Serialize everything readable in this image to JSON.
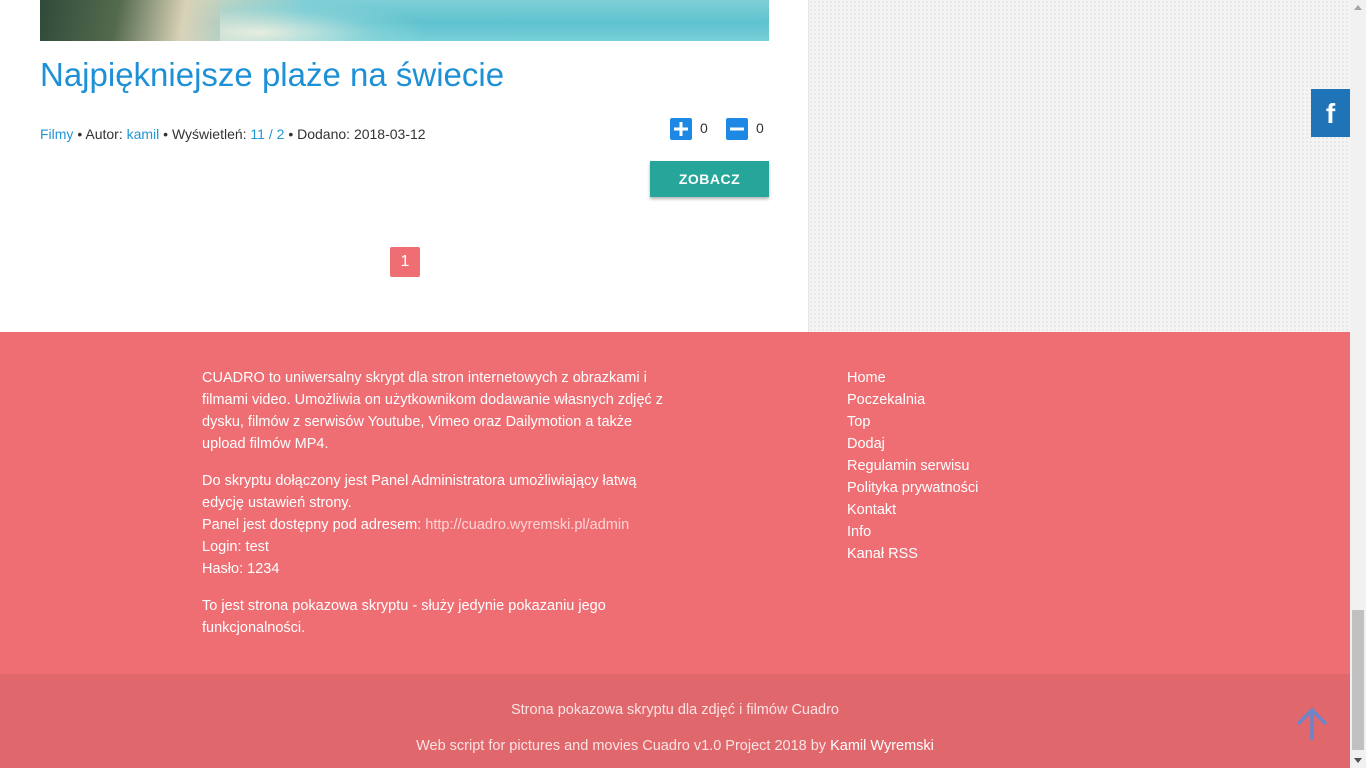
{
  "post": {
    "title": "Najpiękniejsze plaże na świecie",
    "category": "Filmy",
    "author_label": "Autor:",
    "author": "kamil",
    "views_label": "Wyświetleń:",
    "views": "11",
    "views_sep": "/",
    "views_unique": "2",
    "added_label": "Dodano:",
    "added_date": "2018-03-12",
    "dot": "•",
    "vote_up_count": "0",
    "vote_down_count": "0",
    "button_label": "ZOBACZ"
  },
  "pagination": {
    "current": "1"
  },
  "social": {
    "facebook_glyph": "f"
  },
  "footer": {
    "about_p1": "CUADRO to uniwersalny skrypt dla stron internetowych z obrazkami i filmami video. Umożliwia on użytkownikom dodawanie własnych zdjęć z dysku, filmów z serwisów Youtube, Vimeo oraz Dailymotion a także upload filmów MP4.",
    "about_p2_line1": "Do skryptu dołączony jest Panel Administratora umożliwiający łatwą edycję ustawień strony.",
    "about_p2_line2_prefix": "Panel jest dostępny pod adresem:",
    "admin_url": "http://cuadro.wyremski.pl/admin",
    "login_line": "Login: test",
    "password_line": "Hasło: 1234",
    "about_p3": "To jest strona pokazowa skryptu - służy jedynie pokazaniu jego funkcjonalności.",
    "links": [
      "Home",
      "Poczekalnia",
      "Top",
      "Dodaj",
      "Regulamin serwisu",
      "Polityka prywatności",
      "Kontakt",
      "Info",
      "Kanał RSS"
    ],
    "bottom_line1": "Strona pokazowa skryptu dla zdjęć i filmów Cuadro",
    "bottom_line2_prefix": "Web script for pictures and movies Cuadro v1.0 Project 2018 by",
    "bottom_author": "Kamil Wyremski"
  },
  "colors": {
    "link": "#2196d3",
    "footer_bg": "#ee6e73",
    "button": "#26a69a",
    "vote": "#1e88e5",
    "facebook": "#1f73b7"
  },
  "icons": {
    "vote_up": "plus-icon",
    "vote_down": "minus-icon",
    "facebook": "facebook-icon",
    "back_to_top": "arrow-up-icon"
  }
}
